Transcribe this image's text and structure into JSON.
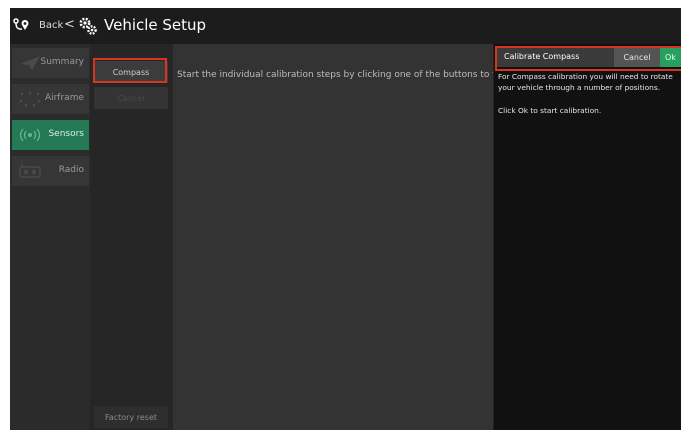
{
  "topbar": {
    "back_label": "Back",
    "chevron": "<",
    "title": "Vehicle Setup",
    "icons": {
      "back": "route-pin-icon",
      "setup": "gears-icon"
    }
  },
  "nav": {
    "items": [
      {
        "label": "Summary",
        "icon": "paper-plane-icon",
        "active": false
      },
      {
        "label": "Airframe",
        "icon": "airframe-dots-icon",
        "active": false
      },
      {
        "label": "Sensors",
        "icon": "sensor-waves-icon",
        "active": true
      },
      {
        "label": "Radio",
        "icon": "radio-controller-icon",
        "active": false
      }
    ]
  },
  "calibration": {
    "compass_label": "Compass",
    "cancel_label": "Cancel",
    "factory_reset_label": "Factory reset"
  },
  "main": {
    "message": "Start the individual calibration steps by clicking one of the buttons to the l"
  },
  "panel": {
    "title": "Calibrate Compass",
    "cancel_label": "Cancel",
    "ok_label": "Ok",
    "text1": "For Compass calibration you will need to rotate your vehicle through a number of positions.",
    "text2": "Click Ok to start calibration."
  },
  "colors": {
    "active_nav": "#237a55",
    "ok_button": "#27a05f",
    "highlight": "#d9341e"
  }
}
